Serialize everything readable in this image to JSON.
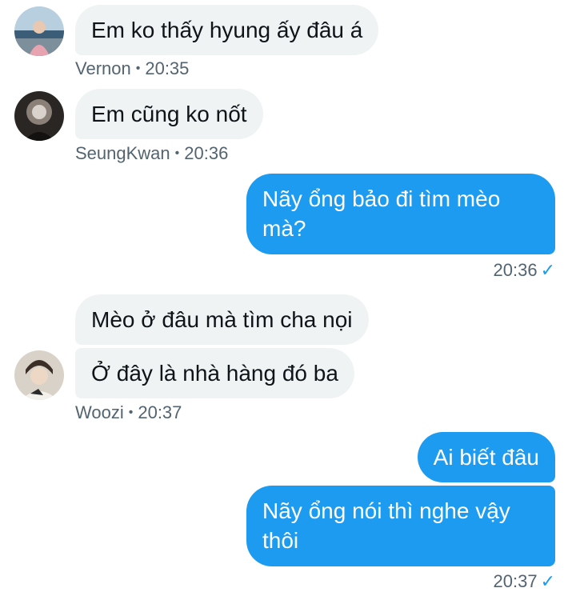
{
  "colors": {
    "incoming_bg": "#eff3f4",
    "outgoing_bg": "#1d9bf0",
    "meta_text": "#536471",
    "check": "#1d9bf0"
  },
  "messages": {
    "m1": {
      "text": "Em ko thấy hyung ấy đâu á",
      "sender": "Vernon",
      "time": "20:35"
    },
    "m2": {
      "text": "Em cũng ko nốt",
      "sender": "SeungKwan",
      "time": "20:36"
    },
    "m3": {
      "text": "Nãy ổng bảo đi tìm mèo mà?",
      "time": "20:36",
      "status_icon": "check-icon"
    },
    "m4": {
      "text": "Mèo ở đâu mà tìm cha nọi"
    },
    "m5": {
      "text": "Ở đây là nhà hàng đó ba",
      "sender": "Woozi",
      "time": "20:37"
    },
    "m6": {
      "text": "Ai biết đâu"
    },
    "m7": {
      "text": "Nãy ổng nói thì nghe vậy thôi",
      "time": "20:37",
      "status_icon": "check-icon"
    }
  },
  "separator": "•",
  "check_glyph": "✓"
}
